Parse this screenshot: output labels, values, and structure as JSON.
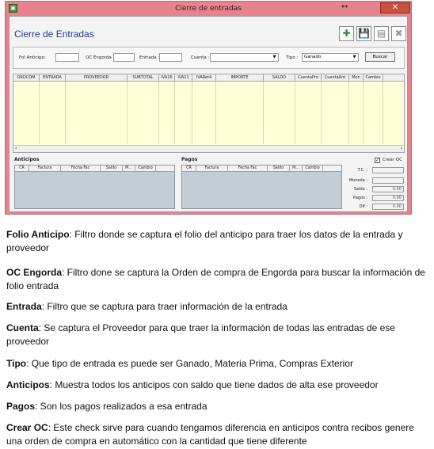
{
  "window": {
    "title": "Cierre de entradas",
    "form_title": "Cierre de Entradas",
    "restore_glyph": "↔",
    "close_glyph": "✕",
    "icons": [
      "new-icon",
      "save-icon",
      "print-icon",
      "cancel-icon"
    ]
  },
  "filters": {
    "folio_anticipo_label": "Fol Anticipo:",
    "oc_engorda_label": "OC Engorda :",
    "entrada_label": "Entrada :",
    "cuenta_label": "Cuenta :",
    "tipo_label": "Tipo :",
    "tipo_value": "Ganado",
    "buscar_label": "Buscar"
  },
  "main_grid": {
    "columns": [
      "ORDCOM",
      "ENTRADA",
      "PROVEEDOR",
      "SUBTOTAL",
      "IVA16",
      "IVA11",
      "IVARet4",
      "IMPORTE",
      "SALDO",
      "CuentaPro",
      "CuentaAnt",
      "Mon",
      "Cambio"
    ]
  },
  "anticipos": {
    "title": "Anticipos",
    "columns": [
      "CR",
      "Factura",
      "Fecha Fac",
      "Saldo",
      "M...",
      "Cambio"
    ]
  },
  "pagos": {
    "title": "Pagos",
    "columns": [
      "CR",
      "Factura",
      "Fecha Fac",
      "Saldo",
      "M...",
      "Cambio"
    ]
  },
  "summary": {
    "crear_oc_label": "Crear OC",
    "crear_oc_checked": true,
    "rows": [
      {
        "label": "T.C. :",
        "value": ""
      },
      {
        "label": "Moneda :",
        "value": ""
      },
      {
        "label": "Saldo :",
        "value": "0.00"
      },
      {
        "label": "Pagos :",
        "value": "0.00"
      },
      {
        "label": "Dif :",
        "value": "0.00"
      }
    ]
  },
  "descriptions": [
    {
      "term": "Folio Anticipo",
      "text": ": Filtro donde se captura el folio del anticipo para traer los datos de la entrada y proveedor"
    },
    {
      "term": "OC Engorda",
      "text": ": Filtro done se captura la Orden de compra de Engorda para buscar la información de folio entrada"
    },
    {
      "term": "Entrada",
      "text": ": Filtro que se captura para traer información de la entrada"
    },
    {
      "term": "Cuenta",
      "text": ": Se captura el Proveedor para que traer la información de todas las entradas de ese proveedor"
    },
    {
      "term": "Tipo",
      "text": ": Que tipo de entrada es puede ser Ganado, Materia Prima, Compras Exterior"
    },
    {
      "term": "Anticipos",
      "text": ": Muestra todos los anticipos con saldo que tiene dados de alta ese proveedor"
    },
    {
      "term": "Pagos",
      "text": ": Son los pagos realizados a esa entrada"
    },
    {
      "term": "Crear OC",
      "text": ": Este check sirve para cuando tengamos diferencia en anticipos contra recibos genere una orden de compra en automático con la cantidad que tiene diferente"
    }
  ]
}
